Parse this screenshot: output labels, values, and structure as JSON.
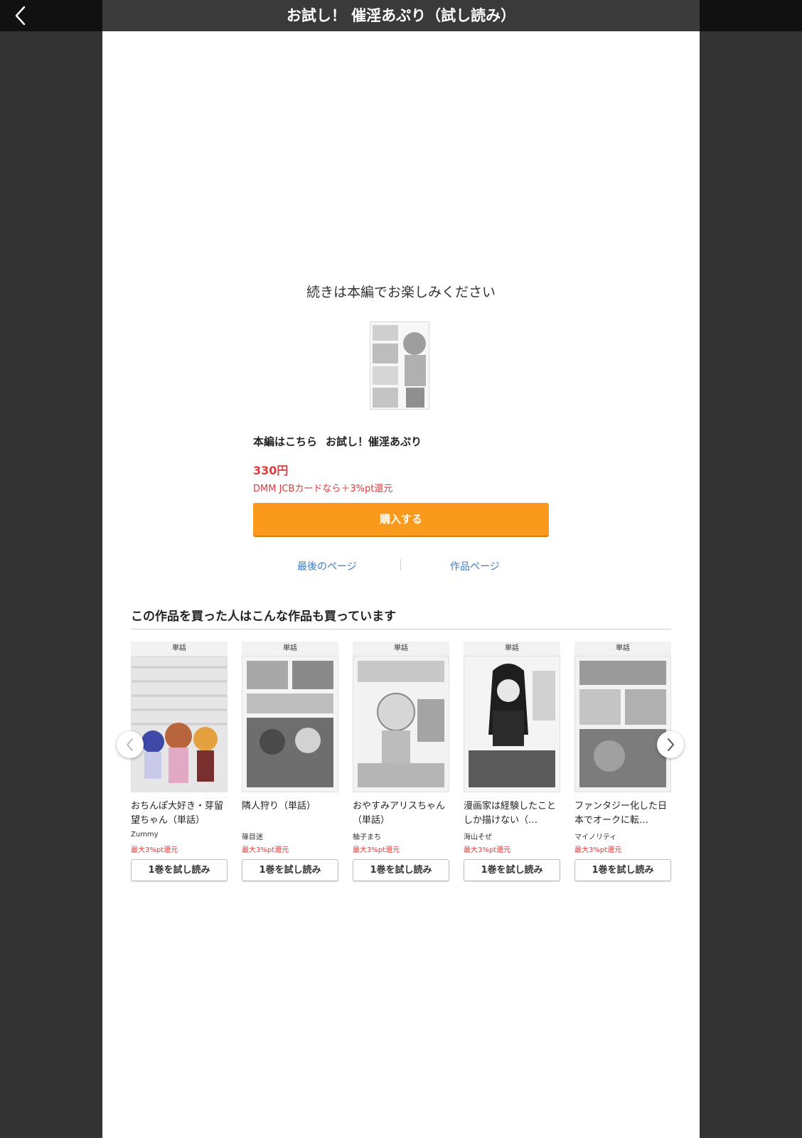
{
  "header": {
    "title": "お試し！ 催淫あぷり（試し読み）"
  },
  "end_panel": {
    "continue_message": "続きは本編でお楽しみください",
    "main_link_prefix": "本編はこちら",
    "main_title": "お試し！催淫あぷり",
    "price": "330円",
    "point_note": "DMM JCBカードなら＋3%pt還元",
    "buy_label": "購入する",
    "last_page_link": "最後のページ",
    "work_page_link": "作品ページ"
  },
  "recommendations": {
    "heading": "この作品を買った人はこんな作品も買っています",
    "items": [
      {
        "label": "単話",
        "title": "おちんぽ大好き・芽留望ちゃん（単話）",
        "author": "Zummy",
        "points": "最大3%pt還元",
        "button": "1巻を試し読み"
      },
      {
        "label": "単話",
        "title": "隣人狩り（単話）",
        "author": "篠目迷",
        "points": "最大3%pt還元",
        "button": "1巻を試し読み"
      },
      {
        "label": "単話",
        "title": "おやすみアリスちゃん（単話）",
        "author": "柚子まち",
        "points": "最大3%pt還元",
        "button": "1巻を試し読み"
      },
      {
        "label": "単話",
        "title": "漫画家は経験したことしか描けない（…",
        "author": "海山そぜ",
        "points": "最大3%pt還元",
        "button": "1巻を試し読み"
      },
      {
        "label": "単話",
        "title": "ファンタジー化した日本でオークに転…",
        "author": "マイノリティ",
        "points": "最大3%pt還元",
        "button": "1巻を試し読み"
      }
    ]
  },
  "colors": {
    "accent": "#f99a1c",
    "price": "#e03a3a",
    "link": "#3d7bc4"
  },
  "icons": {
    "back": "chevron-left-icon",
    "prev": "chevron-left-icon",
    "next": "chevron-right-icon"
  }
}
